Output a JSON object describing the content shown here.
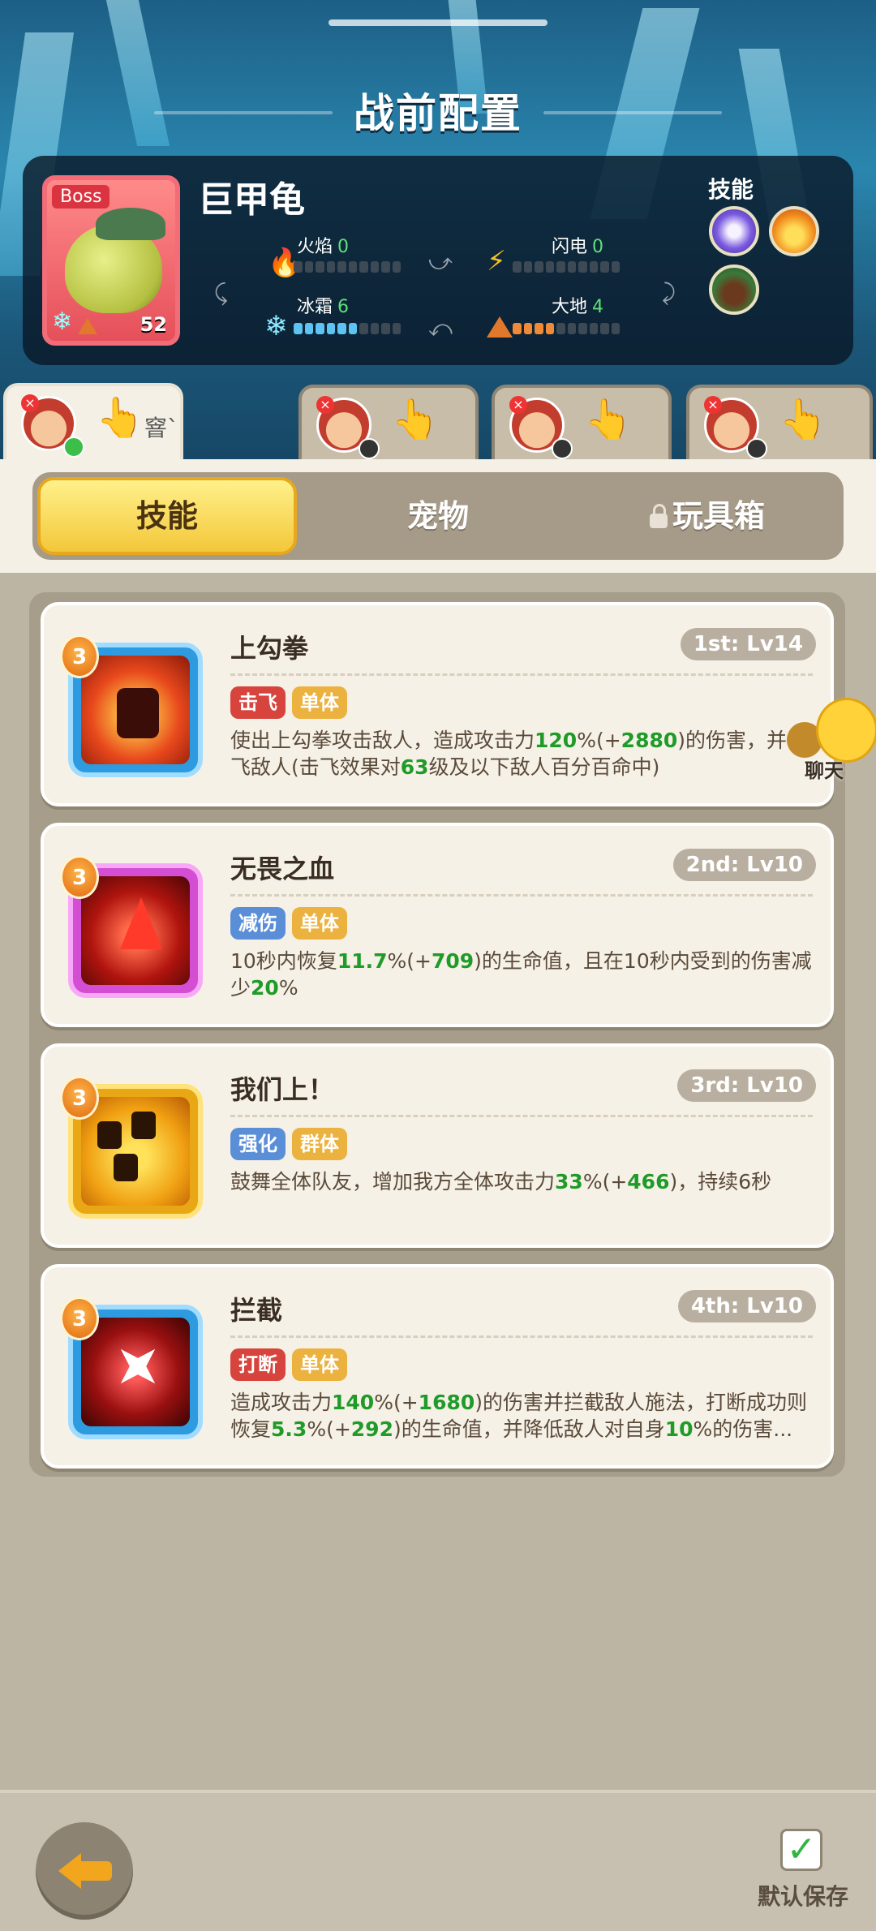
{
  "screen": {
    "title": "战前配置"
  },
  "boss": {
    "tag": "Boss",
    "name": "巨甲龟",
    "level": "52",
    "elements": {
      "fire": {
        "label": "火焰",
        "value": "0"
      },
      "lightning": {
        "label": "闪电",
        "value": "0"
      },
      "frost": {
        "label": "冰霜",
        "value": "6"
      },
      "earth": {
        "label": "大地",
        "value": "4"
      }
    },
    "skills_label": "技能",
    "skill_icons": [
      "vortex-icon",
      "crown-fire-icon",
      "rock-monster-icon"
    ]
  },
  "hero_tabs": [
    {
      "active": true,
      "hint": "窨`"
    },
    {
      "active": false
    },
    {
      "active": false
    },
    {
      "active": false
    }
  ],
  "categories": {
    "skills": "技能",
    "pets": "宠物",
    "toybox": "玩具箱"
  },
  "skills": [
    {
      "cost": "3",
      "name": "上勾拳",
      "level": "1st: Lv14",
      "tags": [
        "击飞",
        "单体"
      ],
      "desc": [
        "使出上勾拳攻击敌人，造成攻击力",
        "120",
        "%(+",
        "2880",
        ")的伤害，并击飞敌人(击飞效果对",
        "63",
        "级及以下敌人百分百命中)"
      ]
    },
    {
      "cost": "3",
      "name": "无畏之血",
      "level": "2nd: Lv10",
      "tags": [
        "减伤",
        "单体"
      ],
      "desc": [
        "10秒内恢复",
        "11.7",
        "%(+",
        "709",
        ")的生命值，且在10秒内受到的伤害减少",
        "20",
        "%"
      ]
    },
    {
      "cost": "3",
      "name": "我们上！",
      "level": "3rd: Lv10",
      "tags": [
        "强化",
        "群体"
      ],
      "desc": [
        "鼓舞全体队友，增加我方全体攻击力",
        "33",
        "%(+",
        "466",
        ")，持续6秒"
      ]
    },
    {
      "cost": "3",
      "name": "拦截",
      "level": "4th: Lv10",
      "tags": [
        "打断",
        "单体"
      ],
      "desc": [
        "造成攻击力",
        "140",
        "%(+",
        "1680",
        ")的伤害并拦截敌人施法，打断成功则恢复",
        "5.3",
        "%(+",
        "292",
        ")的生命值，并降低敌人对自身",
        "10",
        "%的伤害..."
      ]
    }
  ],
  "chat": {
    "label": "聊天"
  },
  "footer": {
    "save_label": "默认保存"
  },
  "colors": {
    "highlight_green": "#1e9b28",
    "tab_active": "#f3c73a",
    "tag_red": "#d6443d",
    "tag_orange": "#ecb23f",
    "tag_blue": "#5a8fd8"
  }
}
